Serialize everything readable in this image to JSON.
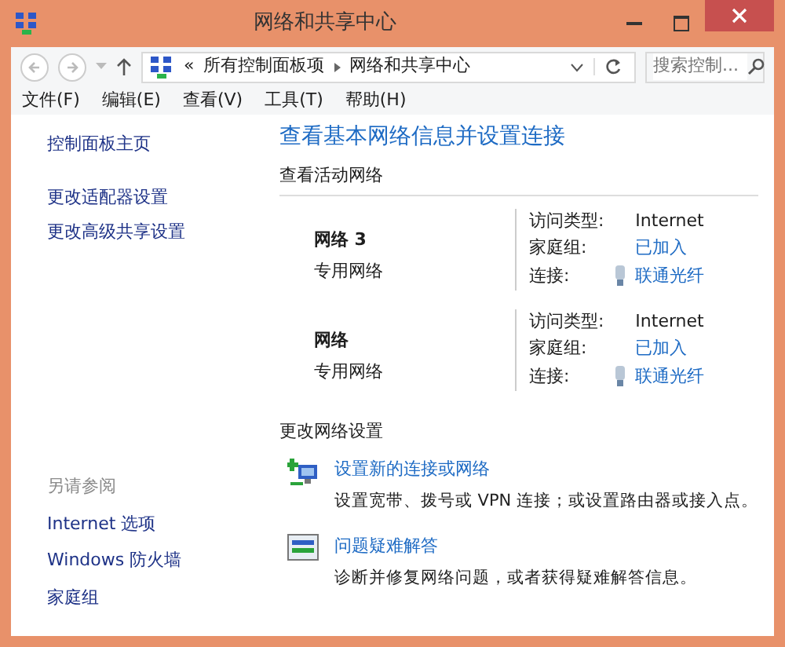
{
  "window": {
    "title": "网络和共享中心"
  },
  "address_bar": {
    "prefix": "«",
    "crumbs": [
      "所有控制面板项",
      "网络和共享中心"
    ],
    "search_placeholder": "搜索控制..."
  },
  "menu": [
    "文件(F)",
    "编辑(E)",
    "查看(V)",
    "工具(T)",
    "帮助(H)"
  ],
  "sidebar": {
    "links": [
      "控制面板主页",
      "更改适配器设置",
      "更改高级共享设置"
    ],
    "see_also_title": "另请参阅",
    "see_also": [
      "Internet 选项",
      "Windows 防火墙",
      "家庭组"
    ]
  },
  "main": {
    "heading": "查看基本网络信息并设置连接",
    "active_title": "查看活动网络",
    "networks": [
      {
        "name": "网络 3",
        "category": "专用网络",
        "access_label": "访问类型:",
        "access": "Internet",
        "homegroup_label": "家庭组:",
        "homegroup": "已加入",
        "connection_label": "连接:",
        "connection": "联通光纤"
      },
      {
        "name": "网络",
        "category": "专用网络",
        "access_label": "访问类型:",
        "access": "Internet",
        "homegroup_label": "家庭组:",
        "homegroup": "已加入",
        "connection_label": "连接:",
        "connection": "联通光纤"
      }
    ],
    "change_title": "更改网络设置",
    "tasks": [
      {
        "kind": "new-connection",
        "link": "设置新的连接或网络",
        "description": "设置宽带、拨号或 VPN 连接；或设置路由器或接入点。"
      },
      {
        "kind": "troubleshoot",
        "link": "问题疑难解答",
        "description": "诊断并修复网络问题，或者获得疑难解答信息。"
      }
    ]
  }
}
